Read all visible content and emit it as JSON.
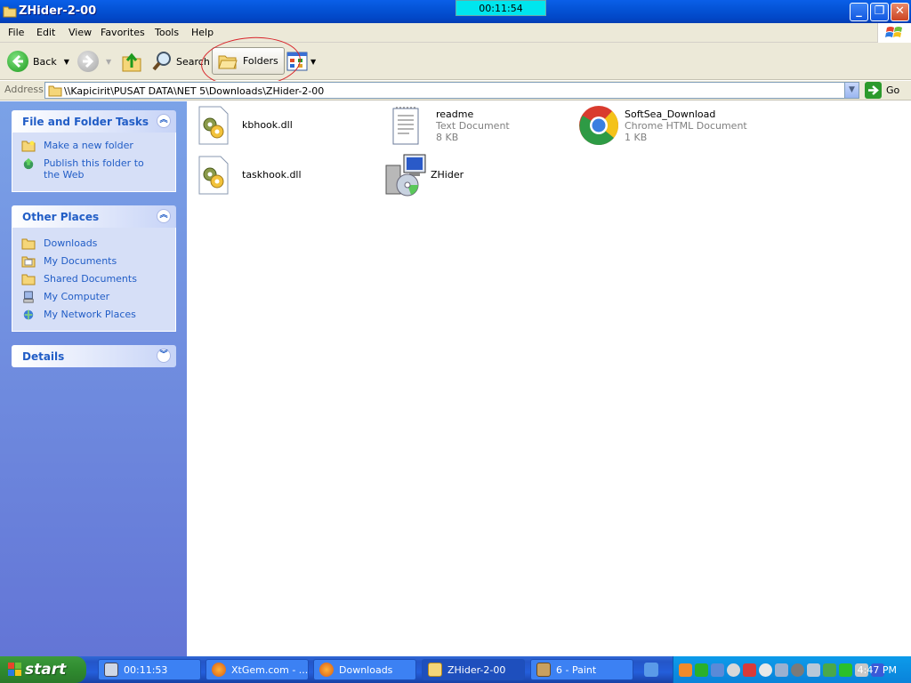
{
  "window": {
    "title": "ZHider-2-00",
    "timer": "00:11:54"
  },
  "menubar": {
    "items": [
      "File",
      "Edit",
      "View",
      "Favorites",
      "Tools",
      "Help"
    ]
  },
  "toolbar": {
    "back_label": "Back",
    "search_label": "Search",
    "folders_label": "Folders"
  },
  "address": {
    "label": "Address",
    "path": "\\\\Kapicirit\\PUSAT DATA\\NET 5\\Downloads\\ZHider-2-00",
    "go_label": "Go"
  },
  "left_pane": {
    "file_tasks": {
      "title": "File and Folder Tasks",
      "items": [
        "Make a new folder",
        "Publish this folder to the Web"
      ]
    },
    "other_places": {
      "title": "Other Places",
      "items": [
        "Downloads",
        "My Documents",
        "Shared Documents",
        "My Computer",
        "My Network Places"
      ]
    },
    "details": {
      "title": "Details"
    }
  },
  "files": [
    {
      "name": "kbhook.dll",
      "type": "",
      "size": "",
      "icon": "dll-icon"
    },
    {
      "name": "readme",
      "type": "Text Document",
      "size": "8 KB",
      "icon": "text-document-icon"
    },
    {
      "name": "SoftSea_Download",
      "type": "Chrome HTML Document",
      "size": "1 KB",
      "icon": "chrome-icon"
    },
    {
      "name": "taskhook.dll",
      "type": "",
      "size": "",
      "icon": "dll-icon"
    },
    {
      "name": "ZHider",
      "type": "",
      "size": "",
      "icon": "installer-icon"
    }
  ],
  "taskbar": {
    "start_label": "start",
    "tasks": [
      "00:11:53",
      "XtGem.com - ...",
      "Downloads",
      "ZHider-2-00",
      "6 - Paint"
    ],
    "clock": "4:47 PM"
  },
  "colors": {
    "title_bar": "#0453d6",
    "task_pane": "#6375d6",
    "link": "#215dc6",
    "annotation": "#d8242a",
    "timer_bg": "#00e6ee"
  }
}
